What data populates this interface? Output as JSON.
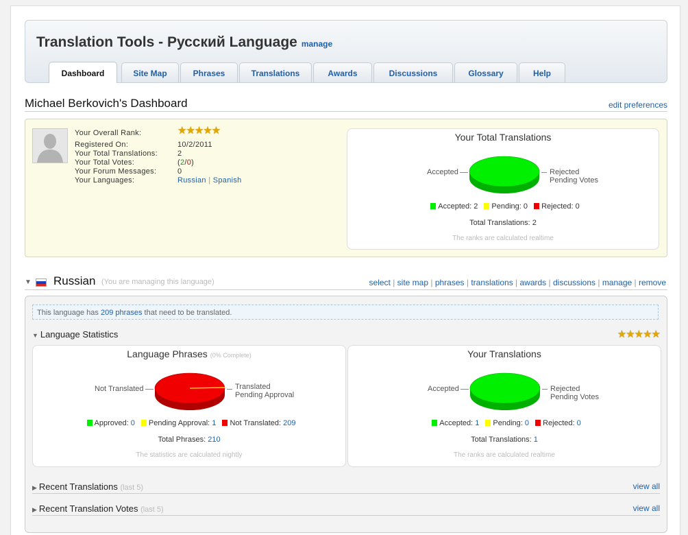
{
  "header": {
    "title": "Translation Tools - Русский Language",
    "manage": "manage",
    "tabs": [
      "Dashboard",
      "Site Map",
      "Phrases",
      "Translations",
      "Awards",
      "Discussions",
      "Glossary",
      "Help"
    ],
    "active_tab": "Dashboard"
  },
  "dashboard": {
    "title": "Michael Berkovich's Dashboard",
    "edit_preferences": "edit preferences",
    "profile": {
      "rank_label": "Your Overall Rank:",
      "rank_stars": 5,
      "registered_label": "Registered On:",
      "registered_value": "10/2/2011",
      "total_translations_label": "Your Total Translations:",
      "total_translations_value": "2",
      "total_votes_label": "Your Total Votes:",
      "votes_open": "(",
      "votes_up": "2",
      "votes_sep": "/",
      "votes_down": "0",
      "votes_close": ")",
      "forum_label": "Your Forum Messages:",
      "forum_value": "0",
      "languages_label": "Your Languages:",
      "languages": [
        "Russian",
        "Spanish"
      ],
      "languages_sep": "|"
    },
    "total_chart": {
      "title": "Your Total Translations",
      "label_left": "Accepted",
      "label_right_1": "Rejected",
      "label_right_2": "Pending Votes",
      "legend": [
        {
          "label": "Accepted: 2",
          "color": "#00ee00"
        },
        {
          "label": "Pending: 0",
          "color": "#ffff00"
        },
        {
          "label": "Rejected: 0",
          "color": "#ee0000"
        }
      ],
      "total": "Total Translations: 2",
      "note": "The ranks are calculated realtime"
    }
  },
  "language": {
    "name": "Russian",
    "managing_note": "(You are managing this language)",
    "links": [
      "select",
      "site map",
      "phrases",
      "translations",
      "awards",
      "discussions",
      "manage",
      "remove"
    ],
    "notice_pre": "This language has ",
    "notice_link": "209 phrases",
    "notice_post": " that need to be translated.",
    "stats_title": "Language Statistics",
    "stats_stars": 5,
    "phrases_chart": {
      "title": "Language Phrases",
      "subtitle": "(0% Complete)",
      "label_left": "Not Translated",
      "label_right_1": "Translated",
      "label_right_2": "Pending Approval",
      "legend": [
        {
          "label": "Approved: ",
          "value": "0",
          "color": "#00ee00"
        },
        {
          "label": "Pending Approval: ",
          "value": "1",
          "color": "#ffff00"
        },
        {
          "label": "Not Translated: ",
          "value": "209",
          "color": "#ee0000"
        }
      ],
      "total_label": "Total Phrases: ",
      "total_value": "210",
      "note": "The statistics are calculated nightly"
    },
    "your_chart": {
      "title": "Your Translations",
      "label_left": "Accepted",
      "label_right_1": "Rejected",
      "label_right_2": "Pending Votes",
      "legend": [
        {
          "label": "Accepted: ",
          "value": "1",
          "color": "#00ee00"
        },
        {
          "label": "Pending: ",
          "value": "0",
          "color": "#ffff00"
        },
        {
          "label": "Rejected: ",
          "value": "0",
          "color": "#ee0000"
        }
      ],
      "total_label": "Total Translations: ",
      "total_value": "1",
      "note": "The ranks are calculated realtime"
    },
    "recent_translations": {
      "title": "Recent Translations",
      "hint": "(last 5)",
      "view_all": "view all"
    },
    "recent_votes": {
      "title": "Recent Translation Votes",
      "hint": "(last 5)",
      "view_all": "view all"
    }
  }
}
